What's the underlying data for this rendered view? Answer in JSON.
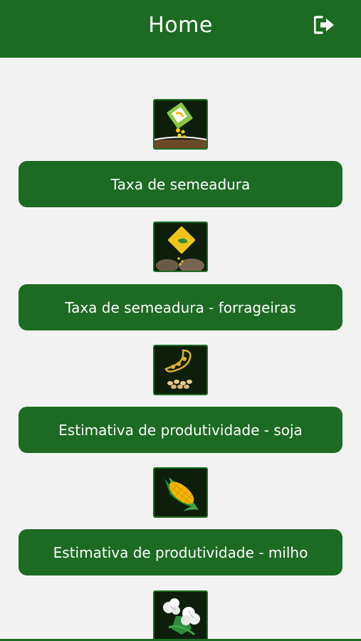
{
  "header": {
    "title": "Home",
    "logout_icon": "logout-icon"
  },
  "menu": {
    "items": [
      {
        "label": "Taxa de semeadura",
        "icon": "seed-packet-icon"
      },
      {
        "label": "Taxa de semeadura - forrageiras",
        "icon": "forage-seed-bag-icon"
      },
      {
        "label": "Estimativa de produtividade - soja",
        "icon": "soybean-pod-icon"
      },
      {
        "label": "Estimativa de produtividade - milho",
        "icon": "corn-cob-icon"
      },
      {
        "icon": "cotton-boll-icon"
      }
    ]
  },
  "colors": {
    "primary": "#1d6b22",
    "background": "#f2f2f2",
    "icon_bg": "#0d1e0b",
    "text": "#ffffff"
  }
}
